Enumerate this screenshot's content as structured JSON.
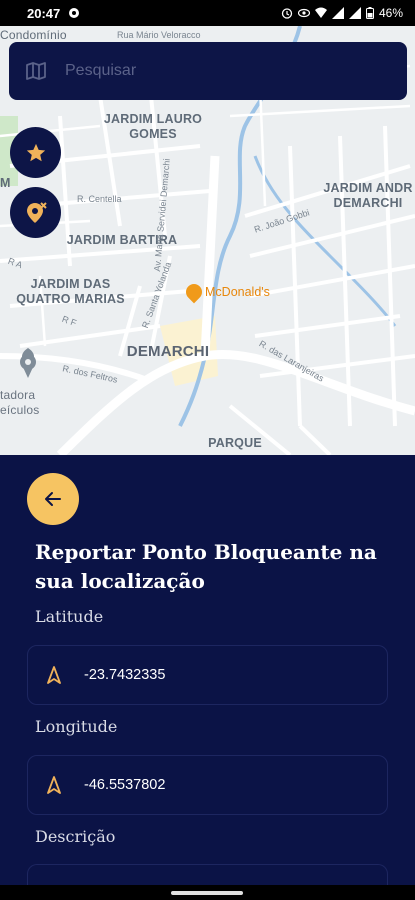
{
  "status_bar": {
    "time": "20:47",
    "battery": "46%",
    "icons": [
      "notification-icon",
      "alarm-icon",
      "eye-icon",
      "wifi-icon",
      "signal-icon",
      "battery-icon"
    ]
  },
  "map": {
    "labels": {
      "condominio": "Condomínio",
      "rua_mario": "Rua Mário Veloracco",
      "jardim_lauro": "JARDIM LAURO\nGOMES",
      "jardim_andre": "JARDIM ANDR\nDEMARCHI",
      "jardim_bartira": "JARDIM BARTIRA",
      "jardim_quatro_marias": "JARDIM DAS\nQUATRO MARIAS",
      "demarchi": "DEMARCHI",
      "parque": "PARQUE",
      "m_left": "M",
      "tadora": "tadora\neículos"
    },
    "streets": {
      "r_centella": "R. Centella",
      "r_joao_gobbi": "R. João Gobbi",
      "av_maria": "Av. Maria Servidei Demarchi",
      "r_santa_yolanda": "R. Santa Yolanda",
      "r_dos_feltros": "R. dos Feltros",
      "r_das_laranjeiras": "R. das Laranjeiras",
      "r_a": "R A",
      "r_f": "R F"
    },
    "poi": "McDonald's"
  },
  "search": {
    "placeholder": "Pesquisar",
    "icon": "map-icon"
  },
  "fabs": {
    "favorites_icon": "star-icon",
    "location_remove_icon": "location-remove-icon"
  },
  "panel": {
    "title": "Reportar Ponto Bloqueante na sua localização",
    "latitude_label": "Latitude",
    "latitude_value": "-23.7432335",
    "longitude_label": "Longitude",
    "longitude_value": "-46.5537802",
    "description_label": "Descrição"
  },
  "colors": {
    "primary": "#0b1346",
    "accent": "#f6c462",
    "icon_accent": "#f0b25a"
  }
}
